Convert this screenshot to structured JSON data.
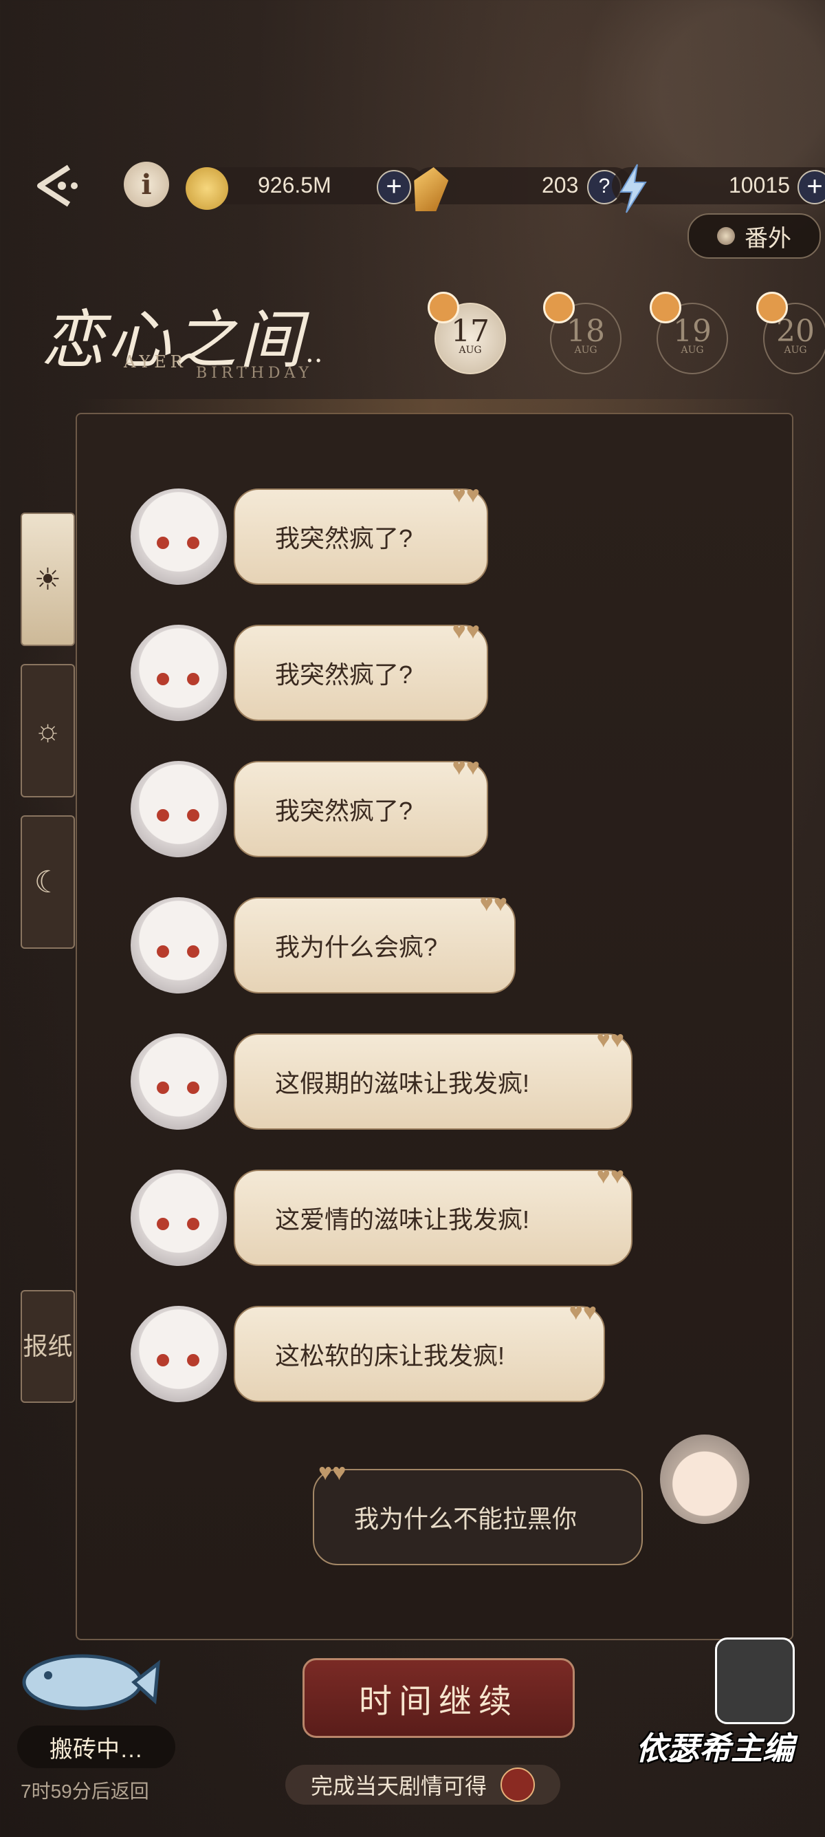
{
  "topbar": {
    "coins": "926.5M",
    "gems": "203",
    "energy": "10015",
    "plus": "+",
    "help": "?",
    "info": "i"
  },
  "extra_button": "番外",
  "logo": {
    "title": "恋心之间",
    "ellipsis": "..",
    "sub1": "AYER",
    "sub2": "BIRTHDAY"
  },
  "dates": [
    {
      "num": "17",
      "mon": "AUG"
    },
    {
      "num": "18",
      "mon": "AUG"
    },
    {
      "num": "19",
      "mon": "AUG"
    },
    {
      "num": "20",
      "mon": "AUG"
    }
  ],
  "side_tabs": {
    "newspaper": "报纸"
  },
  "messages": [
    "我突然疯了?",
    "我突然疯了?",
    "我突然疯了?",
    "我为什么会疯?",
    "这假期的滋味让我发疯!",
    "这爱情的滋味让我发疯!",
    "这松软的床让我发疯!"
  ],
  "reply": "我为什么不能拉黑你",
  "continue_button": "时间继续",
  "reward_text": "完成当天剧情可得",
  "fish": {
    "status": "搬砖中…",
    "timer": "7时59分后返回"
  },
  "signature": "依瑟希主编",
  "icons": {
    "back": "back-arrow-icon",
    "coin": "coin-icon",
    "gem": "gem-icon",
    "energy": "lightning-icon",
    "gift": "gift-icon",
    "sunrise": "sunrise-icon",
    "sun": "sun-icon",
    "moon": "moon-icon",
    "heart": "heart-icon"
  },
  "colors": {
    "accent": "#7a2a25",
    "bubble": "#f4e9d6",
    "panel": "#2a201b"
  }
}
